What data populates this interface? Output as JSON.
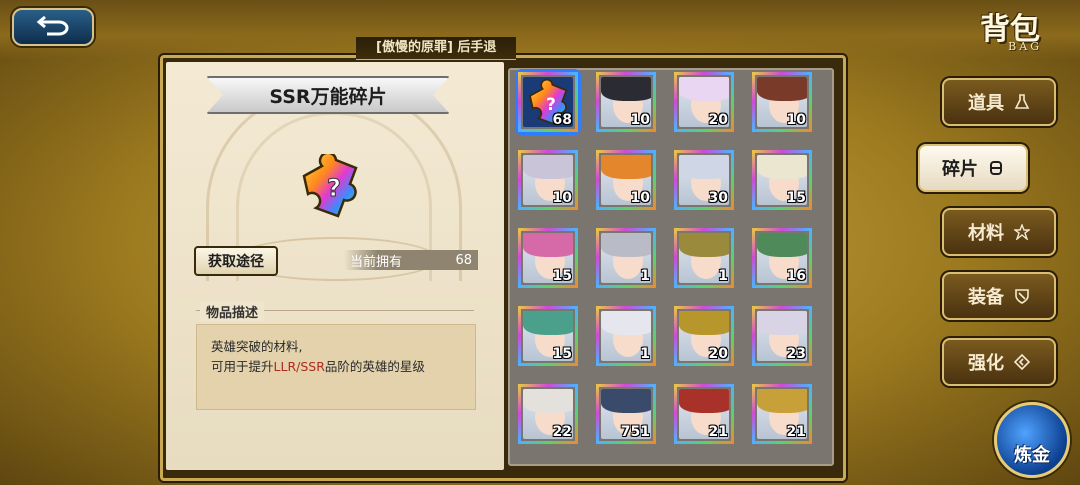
{
  "header": {
    "title": "背包",
    "subtitle": "BAG",
    "banner": "[傲慢的原罪] 后手退"
  },
  "detail": {
    "item_name": "SSR万能碎片",
    "acquire_label": "获取途径",
    "owned_label": "当前拥有",
    "owned_count": "68",
    "desc_section_title": "物品描述",
    "desc_line1": "英雄突破的材料,",
    "desc_line2_prefix": "可用于提升",
    "desc_line2_highlight": "LLR/SSR",
    "desc_line2_suffix": "品阶的英雄的星级"
  },
  "grid": {
    "items": [
      {
        "count": "68",
        "kind": "universal",
        "selected": true
      },
      {
        "count": "10",
        "hair": "#2b2b33"
      },
      {
        "count": "20",
        "hair": "#e9d6f2"
      },
      {
        "count": "10",
        "hair": "#7a3a2a"
      },
      {
        "count": "10",
        "hair": "#c9c4d8"
      },
      {
        "count": "10",
        "hair": "#e3862c"
      },
      {
        "count": "30",
        "hair": "#cfd6e6"
      },
      {
        "count": "15",
        "hair": "#eae6d0"
      },
      {
        "count": "15",
        "hair": "#d66aa8"
      },
      {
        "count": "1",
        "hair": "#b9bcc7"
      },
      {
        "count": "1",
        "hair": "#9a8a3c"
      },
      {
        "count": "16",
        "hair": "#4f8a5a"
      },
      {
        "count": "15",
        "hair": "#4aa08a"
      },
      {
        "count": "1",
        "hair": "#e6e6ee"
      },
      {
        "count": "20",
        "hair": "#b7962c"
      },
      {
        "count": "23",
        "hair": "#d8d4e6"
      },
      {
        "count": "22",
        "hair": "#e4e0dc"
      },
      {
        "count": "751",
        "hair": "#3a4a6a"
      },
      {
        "count": "21",
        "hair": "#a8322a"
      },
      {
        "count": "21",
        "hair": "#c8a03a"
      }
    ]
  },
  "tabs": [
    {
      "label": "道具",
      "icon": "flask-icon",
      "active": false
    },
    {
      "label": "碎片",
      "icon": "fragment-icon",
      "active": true
    },
    {
      "label": "材料",
      "icon": "material-icon",
      "active": false
    },
    {
      "label": "装备",
      "icon": "equipment-icon",
      "active": false
    },
    {
      "label": "强化",
      "icon": "enhance-icon",
      "active": false
    }
  ],
  "alchemy": {
    "label": "炼金"
  }
}
